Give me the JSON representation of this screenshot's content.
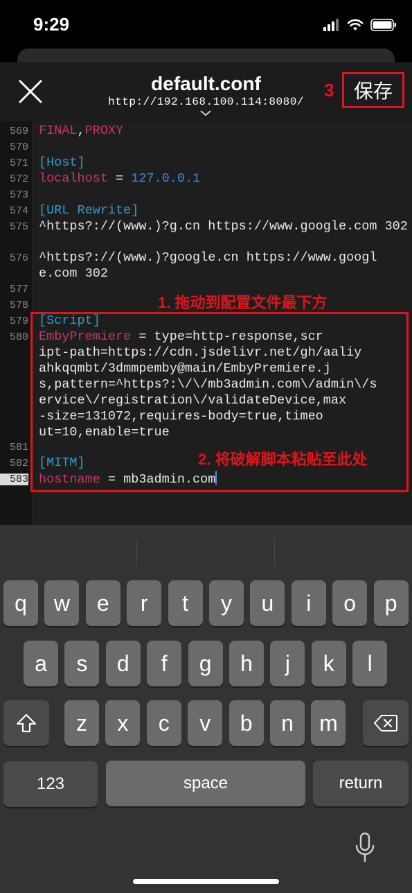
{
  "status": {
    "time": "9:29"
  },
  "header": {
    "title": "default.conf",
    "url": "http://192.168.100.114:8080/",
    "save_label": "保存",
    "step3": "3"
  },
  "editor": {
    "lines": [
      {
        "n": "569",
        "text": "FINAL,PROXY"
      },
      {
        "n": "570",
        "text": ""
      },
      {
        "n": "571",
        "text": "[Host]"
      },
      {
        "n": "572",
        "text": "localhost = 127.0.0.1"
      },
      {
        "n": "573",
        "text": ""
      },
      {
        "n": "574",
        "text": "[URL Rewrite]"
      },
      {
        "n": "575",
        "text": "^https?://(www.)?g.cn https://www.google.com 302"
      },
      {
        "n": "576",
        "text": "^https?://(www.)?google.cn https://www.google.com 302"
      },
      {
        "n": "577",
        "text": ""
      },
      {
        "n": "578",
        "text": ""
      },
      {
        "n": "579",
        "text": "[Script]"
      },
      {
        "n": "580",
        "text": "EmbyPremiere = type=http-response,script-path=https://cdn.jsdelivr.net/gh/aaliyahkqqmbt/3dmmpemby@main/EmbyPremiere.js,pattern=^https?:\\/\\/mb3admin.com\\/admin\\/service\\/registration\\/validateDevice,max-size=131072,requires-body=true,timeout=10,enable=true"
      },
      {
        "n": "581",
        "text": ""
      },
      {
        "n": "582",
        "text": "[MITM]"
      },
      {
        "n": "583",
        "text": "hostname = mb3admin.com"
      }
    ]
  },
  "annotations": {
    "note1": "1. 拖动到配置文件最下方",
    "note2": "2. 将破解脚本粘贴至此处"
  },
  "keyboard": {
    "row1": [
      "q",
      "w",
      "e",
      "r",
      "t",
      "y",
      "u",
      "i",
      "o",
      "p"
    ],
    "row2": [
      "a",
      "s",
      "d",
      "f",
      "g",
      "h",
      "j",
      "k",
      "l"
    ],
    "row3": [
      "z",
      "x",
      "c",
      "v",
      "b",
      "n",
      "m"
    ],
    "numbers": "123",
    "space": "space",
    "return": "return"
  }
}
